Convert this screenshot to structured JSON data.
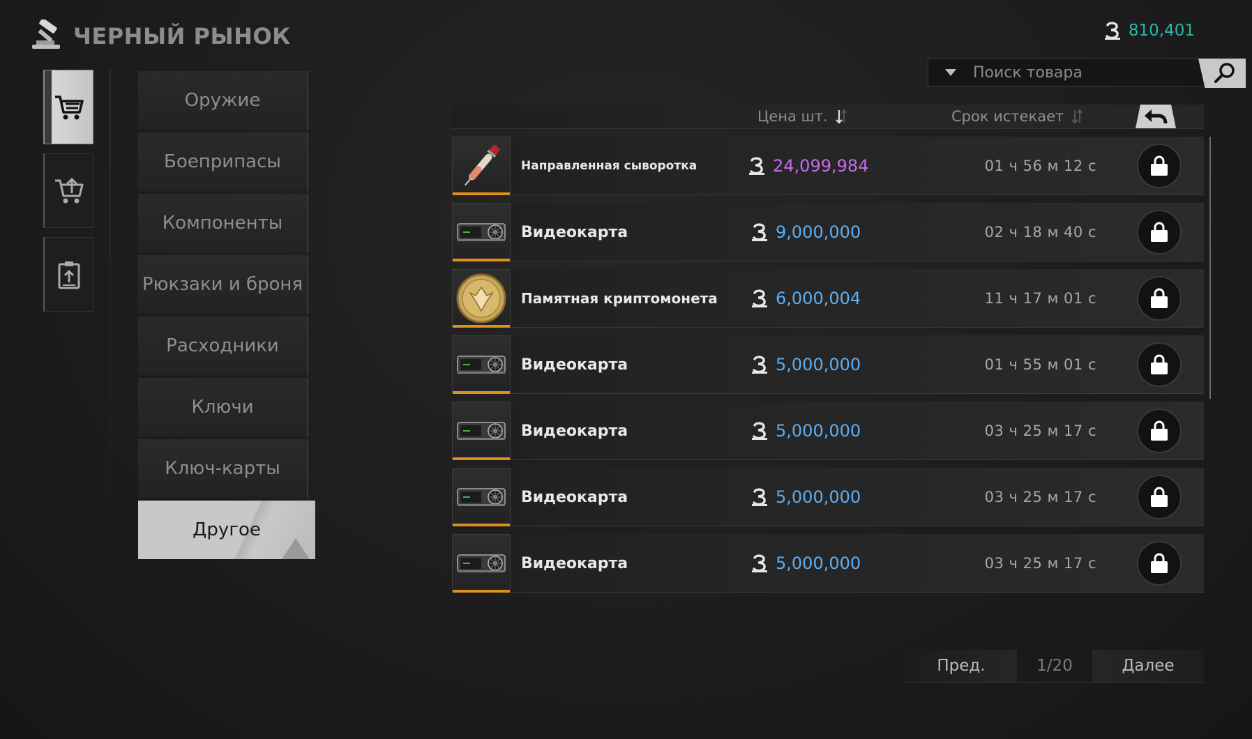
{
  "header": {
    "title": "ЧЕРНЫЙ РЫНОК",
    "balance": "810,401",
    "currency_icon": "currency-icon",
    "balance_color": "#27b9a9"
  },
  "rail": [
    {
      "icon": "cart-icon",
      "active": true
    },
    {
      "icon": "cart-upload-icon",
      "active": false
    },
    {
      "icon": "clipboard-icon",
      "active": false
    }
  ],
  "categories": [
    {
      "label": "Оружие"
    },
    {
      "label": "Боеприпасы"
    },
    {
      "label": "Компоненты"
    },
    {
      "label": "Рюкзаки и броня"
    },
    {
      "label": "Расходники"
    },
    {
      "label": "Ключи"
    },
    {
      "label": "Ключ-карты"
    },
    {
      "label": "Другое",
      "active": true
    }
  ],
  "search": {
    "placeholder": "Поиск товара"
  },
  "table": {
    "price_header": "Цена шт.",
    "expires_header": "Срок истекает",
    "rows": [
      {
        "name": "Направленная сыворотка",
        "price": "24,099,984",
        "expires": "01 ч 56 м 12 с",
        "icon": "serum-icon",
        "price_color": "#c46be6"
      },
      {
        "name": "Видеокарта",
        "price": "9,000,000",
        "expires": "02 ч 18 м 40 с",
        "icon": "gpu-icon",
        "price_color": "#5eaef0"
      },
      {
        "name": "Памятная криптомонета",
        "price": "6,000,004",
        "expires": "11 ч 17 м 01 с",
        "icon": "coin-icon",
        "price_color": "#5eaef0"
      },
      {
        "name": "Видеокарта",
        "price": "5,000,000",
        "expires": "01 ч 55 м 01 с",
        "icon": "gpu-icon",
        "price_color": "#5eaef0"
      },
      {
        "name": "Видеокарта",
        "price": "5,000,000",
        "expires": "03 ч 25 м 17 с",
        "icon": "gpu-icon",
        "price_color": "#5eaef0"
      },
      {
        "name": "Видеокарта",
        "price": "5,000,000",
        "expires": "03 ч 25 м 17 с",
        "icon": "gpu-icon",
        "price_color": "#5eaef0"
      },
      {
        "name": "Видеокарта",
        "price": "5,000,000",
        "expires": "03 ч 25 м 17 с",
        "icon": "gpu-icon",
        "price_color": "#5eaef0"
      }
    ]
  },
  "pager": {
    "prev": "Пред.",
    "page": "1/20",
    "next": "Далее"
  },
  "colors": {
    "rarity_bar": "#e0901a"
  }
}
